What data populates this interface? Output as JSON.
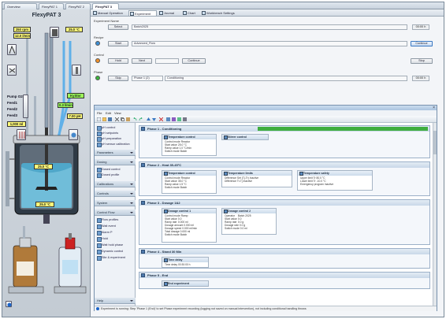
{
  "top_tabs": [
    "Overview",
    "FlexyPAT 1",
    "FlexyPAT 2",
    "FlexyPAT 3"
  ],
  "left": {
    "title": "FlexyPAT 3",
    "readouts": {
      "rpm": "250 rpm",
      "setpoint1": "25.0 °C",
      "min": "12.0 l/min",
      "flow": "0.3 l/min",
      "ph": "7.00 pH",
      "level": "1,000 ml",
      "reactor_temp": "25.0 °C",
      "jacket_temp": "25.0 °C"
    },
    "labels": {
      "pump_o2": "Pump O2",
      "feed1": "Feed1",
      "feed2": "Feed2",
      "feed3": "Feed3",
      "key": "KyStor"
    }
  },
  "main": {
    "subtabs": [
      "Manual Operation",
      "Experiment",
      "Journal",
      "Chart",
      "Workbench Settings"
    ],
    "experiment_label": "Experiment Name",
    "experiment_btn": "Select",
    "experiment_value": "Batch2025",
    "experiment_num": "00:00 h",
    "recipe_label": "Recipe",
    "recipe_btn": "Start",
    "recipe_value": "Advanced_Flow",
    "recipe_num": "00:00 h",
    "recipe_right_btn": "Continue",
    "control_label": "Control",
    "control_btn1": "Hold",
    "control_btn2": "Next",
    "control_btn3": "Continue",
    "control_btn4": "Stop",
    "phase_label": "Phase",
    "phase_btn": "Skip",
    "phase_value": "Phase 1 (2)",
    "phase_value2": "Conditioning",
    "phase_num": "00:00 h"
  },
  "window": {
    "menu": [
      "File",
      "Edit",
      "View"
    ],
    "nav": {
      "sec1_items": [
        "pH control",
        "pH setpoints",
        "pH preparation",
        "pH sensor calibration"
      ],
      "sections": [
        "Parameters",
        "Dosing",
        "Calibrations",
        "Controls",
        "System",
        "Control Flow",
        "Help"
      ],
      "dosing_items": [
        "Dosed control",
        "Dosed profile"
      ],
      "flow_items": [
        "Flow profiles",
        "Wait event",
        "Alarm P",
        "Hold",
        "Wait hold phase",
        "Dynamic control",
        "Site & experiment"
      ]
    },
    "phases": [
      {
        "title": "Phase 1 - Conditioning",
        "cards": [
          {
            "title": "Temperature control",
            "rows": [
              [
                "Control mode",
                "Reactor"
              ],
              [
                "Start value",
                "25.0 °C"
              ],
              [
                "Ramp value",
                "1.0 °C/min"
              ],
              [
                "Switch mode",
                "Batch"
              ]
            ]
          },
          {
            "title": "Stirrer control",
            "rows": []
          }
        ]
      },
      {
        "title": "Phase 2 - Heat 35-45°C",
        "cards": [
          {
            "title": "Temperature control",
            "rows": [
              [
                "Control mode",
                "Reactor"
              ],
              [
                "Start value",
                "35.0 °C"
              ],
              [
                "Ramp value",
                "1.5 °C"
              ],
              [
                "Switch mode",
                "Batch"
              ]
            ]
          },
          {
            "title": "Temperature limits",
            "rows": [
              [
                "Difference Set (Tj-Tr)",
                "Inactive"
              ],
              [
                "Difference Tr-Tj",
                "Inactive"
              ]
            ]
          },
          {
            "title": "Temperature safety",
            "rows": [
              [
                "Upper limit Tr",
                "80.0 °C"
              ],
              [
                "Lower limit Tr",
                "-10.0 °C"
              ],
              [
                "Emergency program",
                "Inactive"
              ]
            ]
          }
        ]
      },
      {
        "title": "Phase 3 - Dosage 1&2",
        "cards": [
          {
            "title": "Dosage control 1",
            "rows": [
              [
                "Control mode",
                "Ramp"
              ],
              [
                "Start value",
                "0.0"
              ],
              [
                "Ramp rate",
                "0.000 ml"
              ],
              [
                "Dosage amount",
                "0.000 ml"
              ],
              [
                "Dosage speed",
                "0.000 ml/min"
              ],
              [
                "Total dosage",
                "0.000 ml"
              ],
              [
                "Switch mode",
                "Batch"
              ]
            ]
          },
          {
            "title": "Dosage control 2",
            "rows": [
              [
                "Operator",
                "Batch 2025"
              ],
              [
                "Start value",
                "0.0"
              ],
              [
                "Ramp rate",
                "0.0 g"
              ],
              [
                "Dosage rate",
                "0.0 g"
              ],
              [
                "Switch mode",
                "0.0 ml"
              ]
            ]
          }
        ]
      },
      {
        "title": "Phase 4 - Stand 30 Min",
        "cards": [
          {
            "title": "Time delay",
            "rows": [
              [
                "Time delay",
                "00:30:00 h"
              ]
            ]
          }
        ]
      },
      {
        "title": "Phase 5 - End",
        "cards": [
          {
            "title": "End experiment",
            "rows": []
          }
        ]
      }
    ],
    "status": "Experiment is running: Step 'Phase 1 (End)' to set Phase experiment recording (logging not saved on manual intervention), not including conditional handling throws"
  },
  "colors": {
    "accent": "#3fae3f",
    "readout": "#fffb7a",
    "readout_green": "#9dff5b",
    "brand": "#3a78c2"
  }
}
